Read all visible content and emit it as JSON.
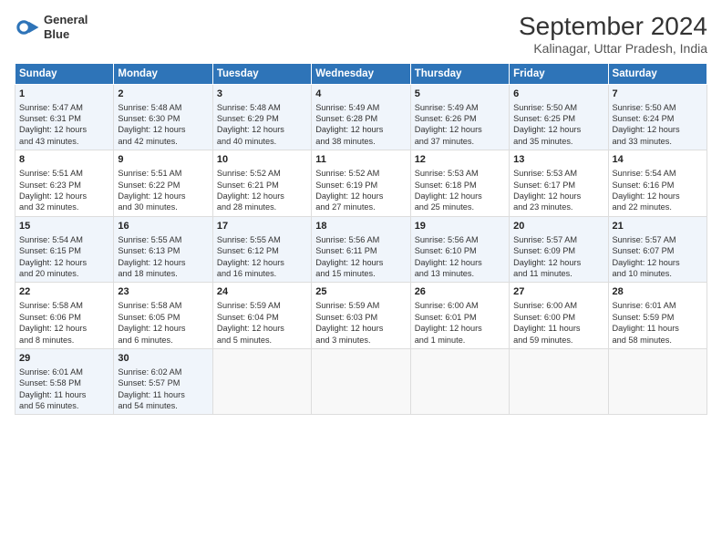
{
  "logo": {
    "line1": "General",
    "line2": "Blue"
  },
  "title": "September 2024",
  "subtitle": "Kalinagar, Uttar Pradesh, India",
  "days_header": [
    "Sunday",
    "Monday",
    "Tuesday",
    "Wednesday",
    "Thursday",
    "Friday",
    "Saturday"
  ],
  "weeks": [
    [
      {
        "day": "1",
        "lines": [
          "Sunrise: 5:47 AM",
          "Sunset: 6:31 PM",
          "Daylight: 12 hours",
          "and 43 minutes."
        ]
      },
      {
        "day": "2",
        "lines": [
          "Sunrise: 5:48 AM",
          "Sunset: 6:30 PM",
          "Daylight: 12 hours",
          "and 42 minutes."
        ]
      },
      {
        "day": "3",
        "lines": [
          "Sunrise: 5:48 AM",
          "Sunset: 6:29 PM",
          "Daylight: 12 hours",
          "and 40 minutes."
        ]
      },
      {
        "day": "4",
        "lines": [
          "Sunrise: 5:49 AM",
          "Sunset: 6:28 PM",
          "Daylight: 12 hours",
          "and 38 minutes."
        ]
      },
      {
        "day": "5",
        "lines": [
          "Sunrise: 5:49 AM",
          "Sunset: 6:26 PM",
          "Daylight: 12 hours",
          "and 37 minutes."
        ]
      },
      {
        "day": "6",
        "lines": [
          "Sunrise: 5:50 AM",
          "Sunset: 6:25 PM",
          "Daylight: 12 hours",
          "and 35 minutes."
        ]
      },
      {
        "day": "7",
        "lines": [
          "Sunrise: 5:50 AM",
          "Sunset: 6:24 PM",
          "Daylight: 12 hours",
          "and 33 minutes."
        ]
      }
    ],
    [
      {
        "day": "8",
        "lines": [
          "Sunrise: 5:51 AM",
          "Sunset: 6:23 PM",
          "Daylight: 12 hours",
          "and 32 minutes."
        ]
      },
      {
        "day": "9",
        "lines": [
          "Sunrise: 5:51 AM",
          "Sunset: 6:22 PM",
          "Daylight: 12 hours",
          "and 30 minutes."
        ]
      },
      {
        "day": "10",
        "lines": [
          "Sunrise: 5:52 AM",
          "Sunset: 6:21 PM",
          "Daylight: 12 hours",
          "and 28 minutes."
        ]
      },
      {
        "day": "11",
        "lines": [
          "Sunrise: 5:52 AM",
          "Sunset: 6:19 PM",
          "Daylight: 12 hours",
          "and 27 minutes."
        ]
      },
      {
        "day": "12",
        "lines": [
          "Sunrise: 5:53 AM",
          "Sunset: 6:18 PM",
          "Daylight: 12 hours",
          "and 25 minutes."
        ]
      },
      {
        "day": "13",
        "lines": [
          "Sunrise: 5:53 AM",
          "Sunset: 6:17 PM",
          "Daylight: 12 hours",
          "and 23 minutes."
        ]
      },
      {
        "day": "14",
        "lines": [
          "Sunrise: 5:54 AM",
          "Sunset: 6:16 PM",
          "Daylight: 12 hours",
          "and 22 minutes."
        ]
      }
    ],
    [
      {
        "day": "15",
        "lines": [
          "Sunrise: 5:54 AM",
          "Sunset: 6:15 PM",
          "Daylight: 12 hours",
          "and 20 minutes."
        ]
      },
      {
        "day": "16",
        "lines": [
          "Sunrise: 5:55 AM",
          "Sunset: 6:13 PM",
          "Daylight: 12 hours",
          "and 18 minutes."
        ]
      },
      {
        "day": "17",
        "lines": [
          "Sunrise: 5:55 AM",
          "Sunset: 6:12 PM",
          "Daylight: 12 hours",
          "and 16 minutes."
        ]
      },
      {
        "day": "18",
        "lines": [
          "Sunrise: 5:56 AM",
          "Sunset: 6:11 PM",
          "Daylight: 12 hours",
          "and 15 minutes."
        ]
      },
      {
        "day": "19",
        "lines": [
          "Sunrise: 5:56 AM",
          "Sunset: 6:10 PM",
          "Daylight: 12 hours",
          "and 13 minutes."
        ]
      },
      {
        "day": "20",
        "lines": [
          "Sunrise: 5:57 AM",
          "Sunset: 6:09 PM",
          "Daylight: 12 hours",
          "and 11 minutes."
        ]
      },
      {
        "day": "21",
        "lines": [
          "Sunrise: 5:57 AM",
          "Sunset: 6:07 PM",
          "Daylight: 12 hours",
          "and 10 minutes."
        ]
      }
    ],
    [
      {
        "day": "22",
        "lines": [
          "Sunrise: 5:58 AM",
          "Sunset: 6:06 PM",
          "Daylight: 12 hours",
          "and 8 minutes."
        ]
      },
      {
        "day": "23",
        "lines": [
          "Sunrise: 5:58 AM",
          "Sunset: 6:05 PM",
          "Daylight: 12 hours",
          "and 6 minutes."
        ]
      },
      {
        "day": "24",
        "lines": [
          "Sunrise: 5:59 AM",
          "Sunset: 6:04 PM",
          "Daylight: 12 hours",
          "and 5 minutes."
        ]
      },
      {
        "day": "25",
        "lines": [
          "Sunrise: 5:59 AM",
          "Sunset: 6:03 PM",
          "Daylight: 12 hours",
          "and 3 minutes."
        ]
      },
      {
        "day": "26",
        "lines": [
          "Sunrise: 6:00 AM",
          "Sunset: 6:01 PM",
          "Daylight: 12 hours",
          "and 1 minute."
        ]
      },
      {
        "day": "27",
        "lines": [
          "Sunrise: 6:00 AM",
          "Sunset: 6:00 PM",
          "Daylight: 11 hours",
          "and 59 minutes."
        ]
      },
      {
        "day": "28",
        "lines": [
          "Sunrise: 6:01 AM",
          "Sunset: 5:59 PM",
          "Daylight: 11 hours",
          "and 58 minutes."
        ]
      }
    ],
    [
      {
        "day": "29",
        "lines": [
          "Sunrise: 6:01 AM",
          "Sunset: 5:58 PM",
          "Daylight: 11 hours",
          "and 56 minutes."
        ]
      },
      {
        "day": "30",
        "lines": [
          "Sunrise: 6:02 AM",
          "Sunset: 5:57 PM",
          "Daylight: 11 hours",
          "and 54 minutes."
        ]
      },
      {
        "day": "",
        "lines": []
      },
      {
        "day": "",
        "lines": []
      },
      {
        "day": "",
        "lines": []
      },
      {
        "day": "",
        "lines": []
      },
      {
        "day": "",
        "lines": []
      }
    ]
  ]
}
